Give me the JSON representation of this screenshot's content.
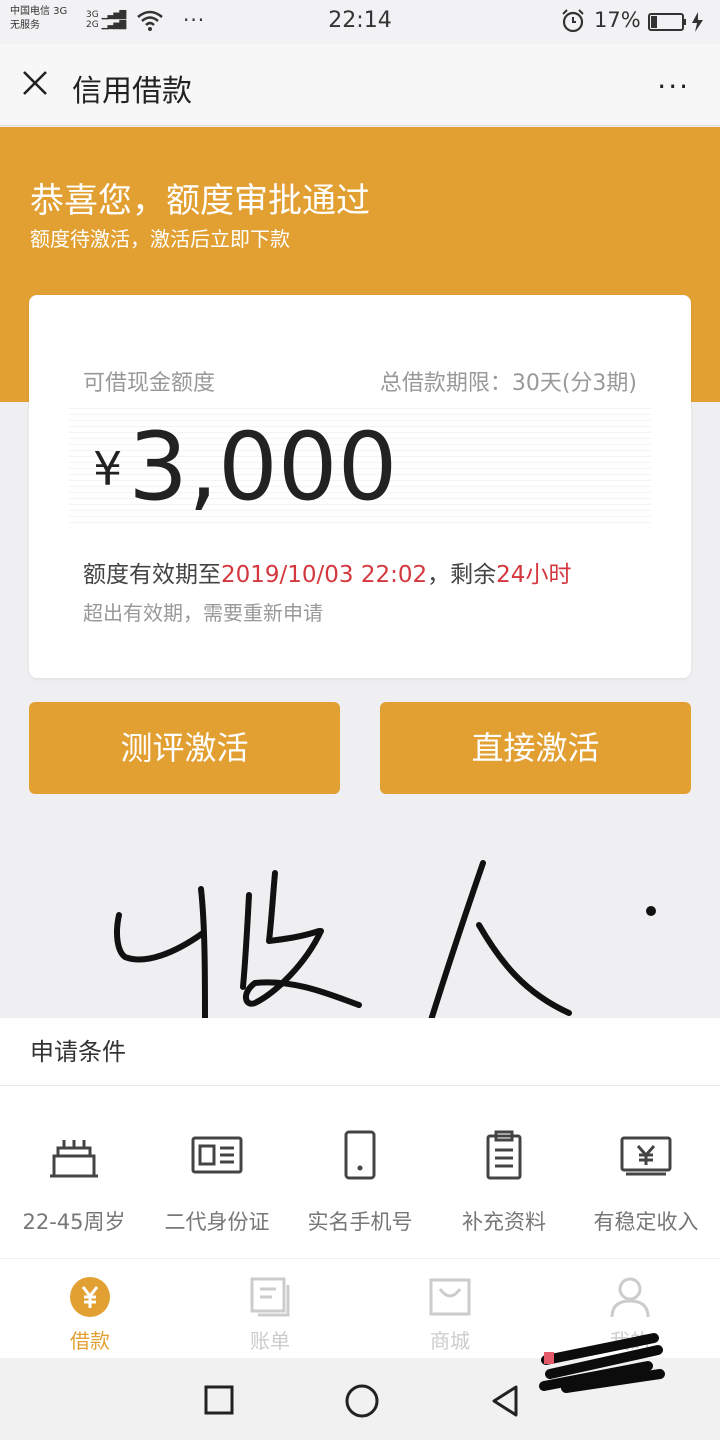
{
  "status": {
    "carrier_line1": "中国电信 3G",
    "carrier_line2": "无服务",
    "signal_line1": "3G",
    "signal_line2": "2G",
    "more": "···",
    "time": "22:14",
    "battery": "17%"
  },
  "nav": {
    "title": "信用借款",
    "menu": "···"
  },
  "banner": {
    "headline": "恭喜您，额度审批通过",
    "subline": "额度待激活，激活后立即下款"
  },
  "card": {
    "label": "可借现金额度",
    "term": "总借款期限：30天(分3期)",
    "currency": "¥",
    "amount": "3,000",
    "validity_prefix": "额度有效期至",
    "validity_date": "2019/10/03 22:02",
    "validity_mid": "，剩余",
    "validity_remaining": "24小时",
    "note": "超出有效期，需要重新申请"
  },
  "buttons": {
    "assess": "测评激活",
    "direct": "直接激活"
  },
  "conditions": {
    "heading": "申请条件",
    "items": [
      {
        "label": "22-45周岁",
        "icon": "cake-icon"
      },
      {
        "label": "二代身份证",
        "icon": "id-card-icon"
      },
      {
        "label": "实名手机号",
        "icon": "phone-icon"
      },
      {
        "label": "补充资料",
        "icon": "clipboard-icon"
      },
      {
        "label": "有稳定收入",
        "icon": "income-icon"
      }
    ]
  },
  "tabs": [
    {
      "label": "借款",
      "icon": "yen-coin-icon"
    },
    {
      "label": "账单",
      "icon": "bill-icon"
    },
    {
      "label": "商城",
      "icon": "shop-icon"
    },
    {
      "label": "我的",
      "icon": "user-icon"
    }
  ],
  "colors": {
    "accent": "#e2a033",
    "highlight": "#d4373e"
  }
}
